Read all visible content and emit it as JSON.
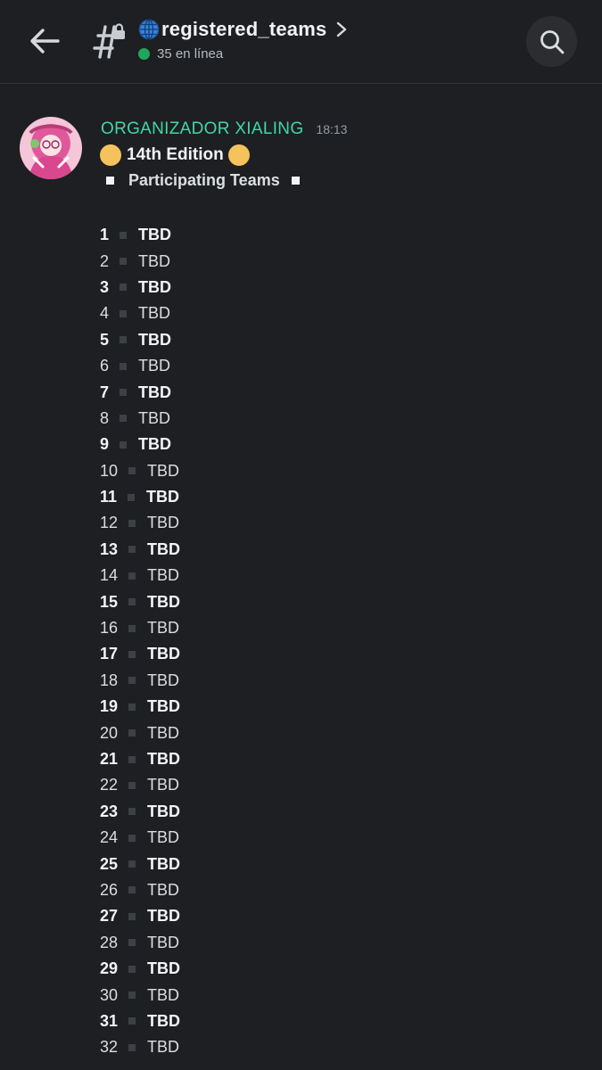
{
  "header": {
    "channel_name": "registered_teams",
    "online_count": "35 en línea",
    "icons": {
      "back": "arrow-left-icon",
      "channel": "locked-hash-icon",
      "globe": "globe-icon",
      "chevron": "chevron-right-icon",
      "search": "search-icon"
    }
  },
  "message": {
    "author": "ORGANIZADOR XIALING",
    "author_color": "#3ed8a4",
    "timestamp": "18:13",
    "edition": "14th Edition",
    "subtitle": "Participating Teams",
    "teams": [
      {
        "num": "1",
        "name": "TBD",
        "bold": true
      },
      {
        "num": "2",
        "name": "TBD",
        "bold": false
      },
      {
        "num": "3",
        "name": "TBD",
        "bold": true
      },
      {
        "num": "4",
        "name": "TBD",
        "bold": false
      },
      {
        "num": "5",
        "name": "TBD",
        "bold": true
      },
      {
        "num": "6",
        "name": "TBD",
        "bold": false
      },
      {
        "num": "7",
        "name": "TBD",
        "bold": true
      },
      {
        "num": "8",
        "name": "TBD",
        "bold": false
      },
      {
        "num": "9",
        "name": "TBD",
        "bold": true
      },
      {
        "num": "10",
        "name": "TBD",
        "bold": false
      },
      {
        "num": "11",
        "name": "TBD",
        "bold": true
      },
      {
        "num": "12",
        "name": "TBD",
        "bold": false
      },
      {
        "num": "13",
        "name": "TBD",
        "bold": true
      },
      {
        "num": "14",
        "name": "TBD",
        "bold": false
      },
      {
        "num": "15",
        "name": "TBD",
        "bold": true
      },
      {
        "num": "16",
        "name": "TBD",
        "bold": false
      },
      {
        "num": "17",
        "name": "TBD",
        "bold": true
      },
      {
        "num": "18",
        "name": "TBD",
        "bold": false
      },
      {
        "num": "19",
        "name": "TBD",
        "bold": true
      },
      {
        "num": "20",
        "name": "TBD",
        "bold": false
      },
      {
        "num": "21",
        "name": "TBD",
        "bold": true
      },
      {
        "num": "22",
        "name": "TBD",
        "bold": false
      },
      {
        "num": "23",
        "name": "TBD",
        "bold": true
      },
      {
        "num": "24",
        "name": "TBD",
        "bold": false
      },
      {
        "num": "25",
        "name": "TBD",
        "bold": true
      },
      {
        "num": "26",
        "name": "TBD",
        "bold": false
      },
      {
        "num": "27",
        "name": "TBD",
        "bold": true
      },
      {
        "num": "28",
        "name": "TBD",
        "bold": false
      },
      {
        "num": "29",
        "name": "TBD",
        "bold": true
      },
      {
        "num": "30",
        "name": "TBD",
        "bold": false
      },
      {
        "num": "31",
        "name": "TBD",
        "bold": true
      },
      {
        "num": "32",
        "name": "TBD",
        "bold": false
      }
    ]
  }
}
